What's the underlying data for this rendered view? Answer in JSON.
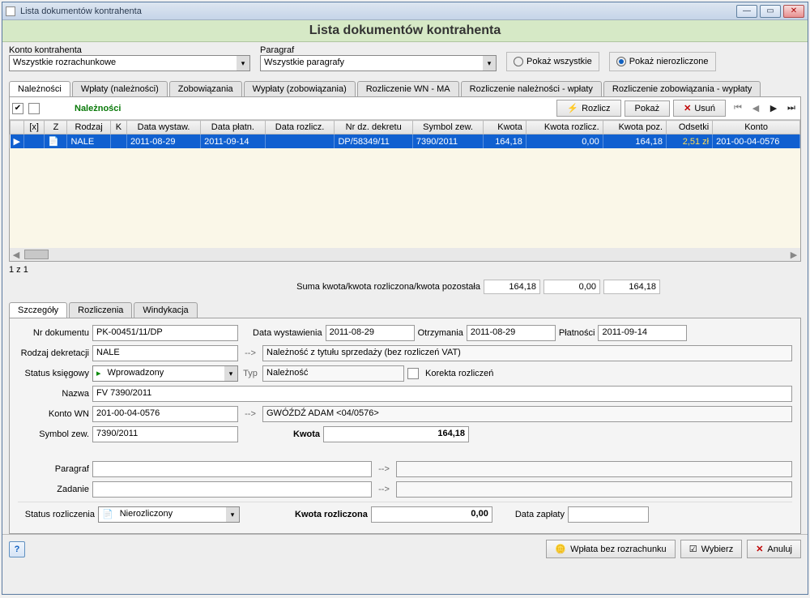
{
  "title": "Lista dokumentów kontrahenta",
  "header": "Lista dokumentów kontrahenta",
  "filters": {
    "konto_label": "Konto kontrahenta",
    "konto_value": "Wszystkie rozrachunkowe",
    "paragraf_label": "Paragraf",
    "paragraf_value": "Wszystkie paragrafy",
    "radio_all": "Pokaż wszystkie",
    "radio_unsettled": "Pokaż nierozliczone"
  },
  "maintabs": [
    "Należności",
    "Wpłaty (należności)",
    "Zobowiązania",
    "Wypłaty (zobowiązania)",
    "Rozliczenie WN - MA",
    "Rozliczenie należności - wpłaty",
    "Rozliczenie zobowiązania - wypłaty"
  ],
  "gridlabel": "Należności",
  "toolbar": {
    "rozlicz": "Rozlicz",
    "pokaz": "Pokaż",
    "usun": "Usuń"
  },
  "cols": [
    "[x]",
    "Z",
    "Rodzaj",
    "K",
    "Data wystaw.",
    "Data płatn.",
    "Data rozlicz.",
    "Nr dz. dekretu",
    "Symbol zew.",
    "Kwota",
    "Kwota rozlicz.",
    "Kwota poz.",
    "Odsetki",
    "Konto"
  ],
  "row": {
    "rodzaj": "NALE",
    "dwyst": "2011-08-29",
    "dplat": "2011-09-14",
    "drozl": "",
    "nrdz": "DP/58349/11",
    "sym": "7390/2011",
    "kwota": "164,18",
    "krozl": "0,00",
    "kpoz": "164,18",
    "ods": "2,51 zł",
    "konto": "201-00-04-0576"
  },
  "count": "1 z 1",
  "sum": {
    "label": "Suma kwota/kwota rozliczona/kwota pozostała",
    "v1": "164,18",
    "v2": "0,00",
    "v3": "164,18"
  },
  "dtabs": [
    "Szczegóły",
    "Rozliczenia",
    "Windykacja"
  ],
  "det": {
    "nrdok_l": "Nr dokumentu",
    "nrdok": "PK-00451/11/DP",
    "dwyst_l": "Data wystawienia",
    "dwyst": "2011-08-29",
    "dotrz_l": "Otrzymania",
    "dotrz": "2011-08-29",
    "dplat_l": "Płatności",
    "dplat": "2011-09-14",
    "rodz_l": "Rodzaj dekretacji",
    "rodz": "NALE",
    "rodz_desc": "Należność z tytułu sprzedaży (bez rozliczeń VAT)",
    "stat_l": "Status księgowy",
    "stat": "Wprowadzony",
    "typ_l": "Typ",
    "typ": "Należność",
    "korekta": "Korekta rozliczeń",
    "nazwa_l": "Nazwa",
    "nazwa": "FV 7390/2011",
    "kwn_l": "Konto WN",
    "kwn": "201-00-04-0576",
    "kwn_desc": "GWÓŹDŹ ADAM <04/0576>",
    "sym_l": "Symbol zew.",
    "sym": "7390/2011",
    "kwota_l": "Kwota",
    "kwota": "164,18",
    "par_l": "Paragraf",
    "zad_l": "Zadanie",
    "statr_l": "Status rozliczenia",
    "statr": "Nierozliczony",
    "kwr_l": "Kwota rozliczona",
    "kwr": "0,00",
    "dzap_l": "Data zapłaty"
  },
  "footer": {
    "wplata": "Wpłata bez rozrachunku",
    "wybierz": "Wybierz",
    "anuluj": "Anuluj"
  }
}
